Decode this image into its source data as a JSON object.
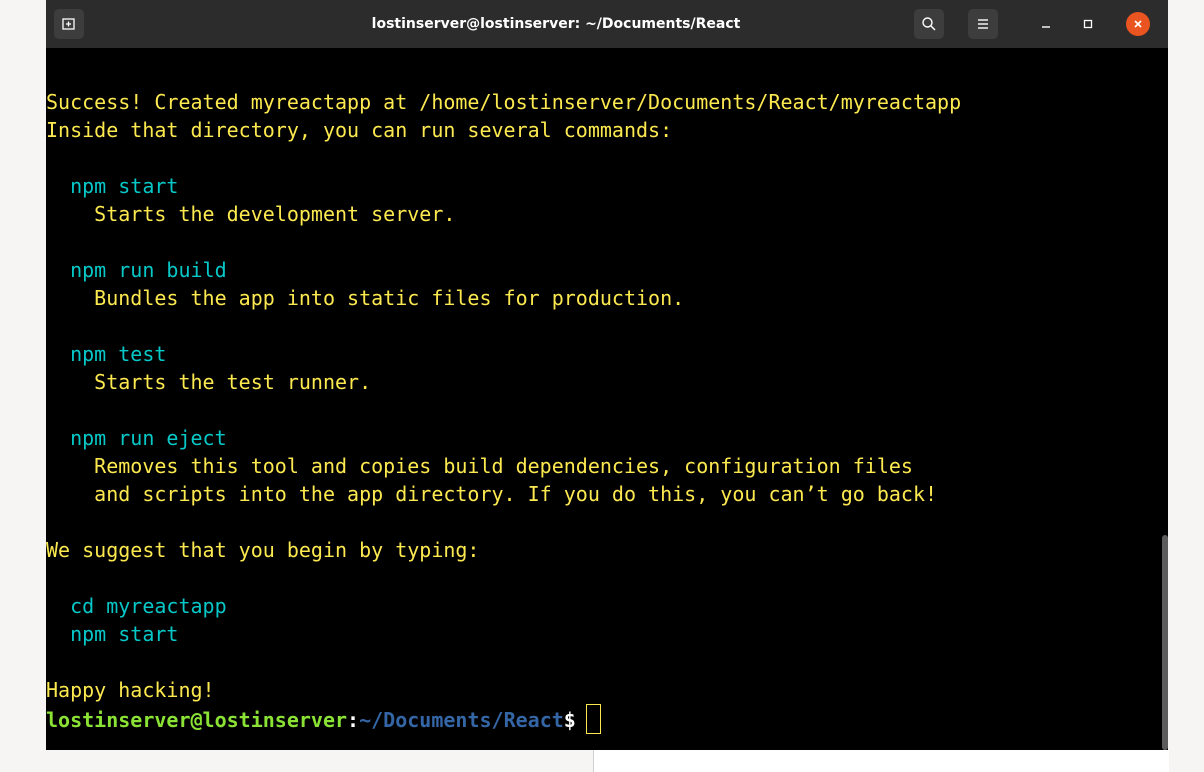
{
  "window": {
    "title": "lostinserver@lostinserver: ~/Documents/React"
  },
  "icons": {
    "new_tab": "new-tab-icon",
    "search": "search-icon",
    "menu": "hamburger-menu-icon",
    "minimize": "minimize-icon",
    "maximize": "maximize-icon",
    "close": "close-icon"
  },
  "colors": {
    "yellow": "#fce94f",
    "cyan": "#06c8c8",
    "prompt_user": "#8ae234",
    "prompt_path": "#3465a4",
    "close_button": "#e95420"
  },
  "terminal": {
    "success": "Success! Created myreactapp at /home/lostinserver/Documents/React/myreactapp",
    "inside": "Inside that directory, you can run several commands:",
    "cmd_start": "  npm start",
    "desc_start": "    Starts the development server.",
    "cmd_build": "  npm run build",
    "desc_build": "    Bundles the app into static files for production.",
    "cmd_test": "  npm test",
    "desc_test": "    Starts the test runner.",
    "cmd_eject": "  npm run eject",
    "desc_eject_1": "    Removes this tool and copies build dependencies, configuration files",
    "desc_eject_2": "    and scripts into the app directory. If you do this, you can’t go back!",
    "suggest": "We suggest that you begin by typing:",
    "cmd_cd": "  cd myreactapp",
    "cmd_start_2": "  npm start",
    "happy": "Happy hacking!",
    "prompt": {
      "user_host": "lostinserver@lostinserver",
      "colon": ":",
      "path": "~/Documents/React",
      "dollar": "$"
    }
  }
}
